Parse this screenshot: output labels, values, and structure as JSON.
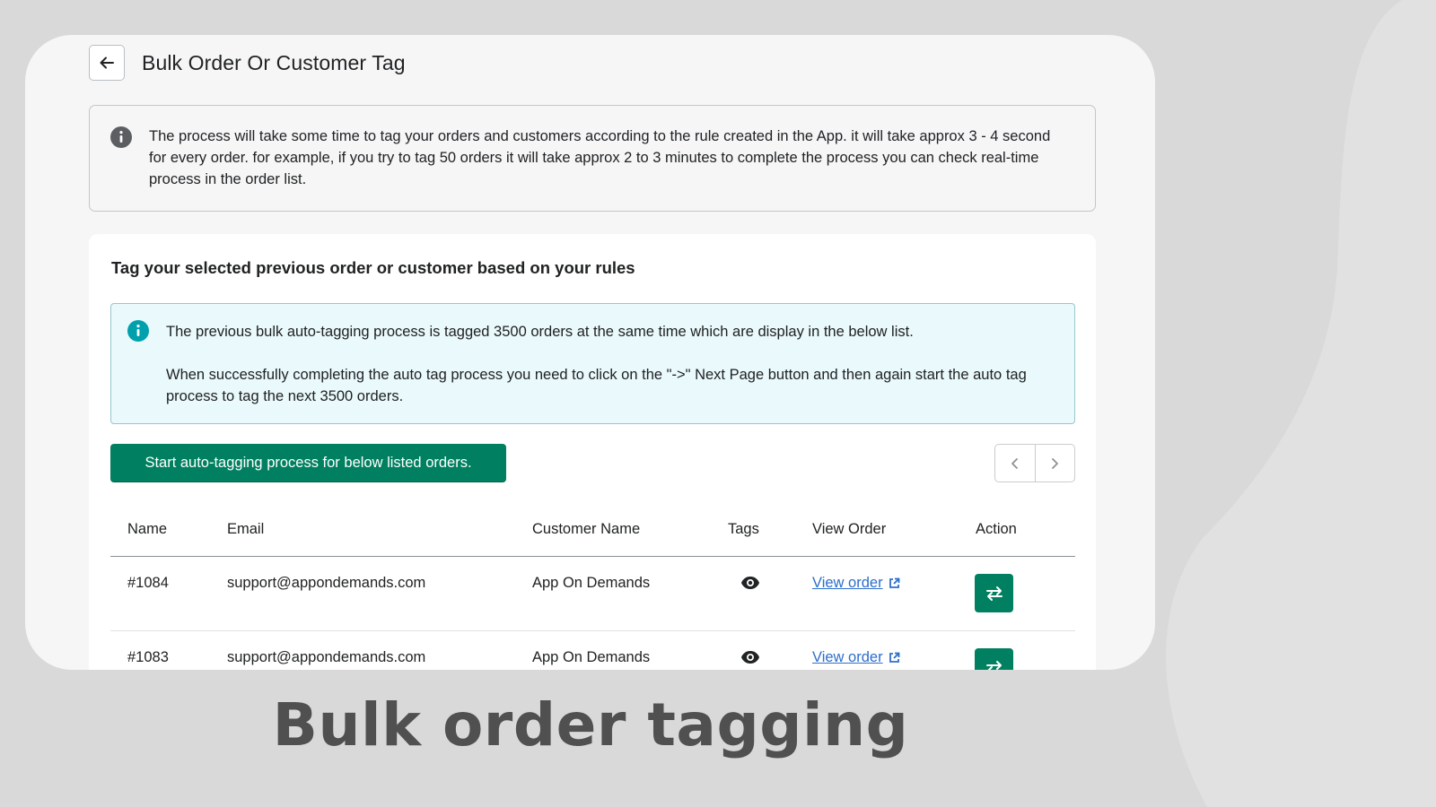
{
  "header": {
    "title": "Bulk Order Or Customer Tag",
    "back_icon": "arrow-left-icon"
  },
  "notice": {
    "icon": "info-circle-icon",
    "text": "The process will take some time to tag your orders and customers according to the rule created in the App. it will take approx 3 - 4 second for every order. for example, if you try to tag 50 orders it will take approx 2 to 3 minutes to complete the process you can check real-time process in the order list."
  },
  "panel": {
    "title": "Tag your selected previous order or customer based on your rules",
    "banner": {
      "icon": "info-circle-icon",
      "line1": "The previous bulk auto-tagging process is tagged 3500 orders at the same time which are display in the below list.",
      "line2": "When successfully completing the auto tag process you need to click on the \"->\" Next Page button and then again start the auto tag process to tag the next 3500 orders."
    },
    "start_button_label": "Start auto-tagging process for below listed orders.",
    "pager": {
      "prev_icon": "chevron-left-icon",
      "next_icon": "chevron-right-icon"
    }
  },
  "table": {
    "columns": [
      "Name",
      "Email",
      "Customer Name",
      "Tags",
      "View Order",
      "Action"
    ],
    "rows": [
      {
        "name": "#1084",
        "email": "support@appondemands.com",
        "customer_name": "App On Demands",
        "tags_icon": "eye-icon",
        "view_label": "View order",
        "action_icon": "swap-arrows-icon"
      },
      {
        "name": "#1083",
        "email": "support@appondemands.com",
        "customer_name": "App On Demands",
        "tags_icon": "eye-icon",
        "view_label": "View order",
        "action_icon": "swap-arrows-icon"
      }
    ]
  },
  "caption": "Bulk order tagging",
  "colors": {
    "primary": "#008060",
    "link": "#2c6ecb",
    "banner_bg": "#eaf9fc",
    "banner_icon": "#00a0ac",
    "backdrop": "#d9d9d9"
  }
}
